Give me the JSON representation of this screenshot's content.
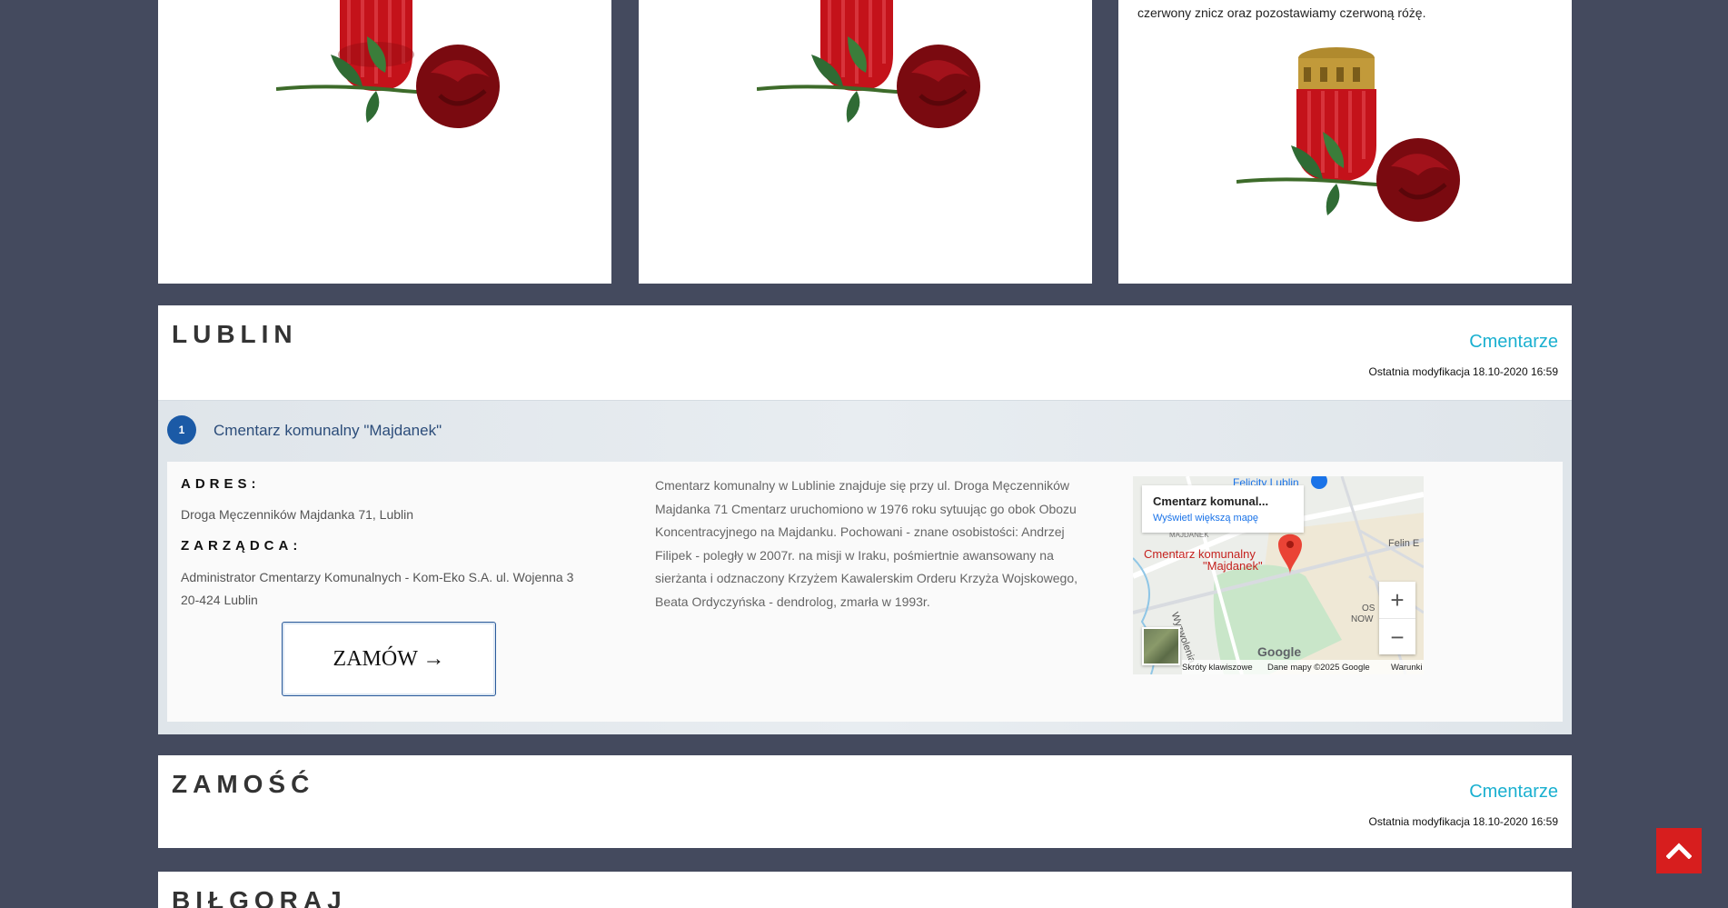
{
  "top_cards": [
    {
      "caption": ""
    },
    {
      "caption": ""
    },
    {
      "caption": "czerwony znicz oraz pozostawiamy czerwoną różę."
    }
  ],
  "lublin": {
    "title": "LUBLIN",
    "category_link": "Cmentarze",
    "modified_label": "Ostatnia modyfikacja",
    "modified_value": "18.10-2020 16:59",
    "cemetery": {
      "number": "1",
      "name": "Cmentarz komunalny \"Majdanek\"",
      "address_label": "ADRES:",
      "address": "Droga Męczenników Majdanka 71, Lublin",
      "manager_label": "ZARZĄDCA:",
      "manager_line1": "Administrator Cmentarzy Komunalnych - Kom-Eko S.A. ul. Wojenna 3",
      "manager_line2": "20-424 Lublin",
      "order_button": "ZAMÓW →",
      "description": "Cmentarz komunalny w Lublinie znajduje się przy ul. Droga Męczenników Majdanka 71 Cmentarz uruchomiono w 1976 roku sytuując go obok Obozu Koncentracyjnego na Majdanku. Pochowani - znane osobistości: Andrzej Filipek - poległy w 2007r. na misji w Iraku, pośmiertnie awansowany na sierżanta i odznaczony Krzyżem Kawalerskim Orderu Krzyża Wojskowego, Beata Ordyczyńska - dendrolog, zmarła w 1993r."
    },
    "map": {
      "info_title": "Cmentarz komunal...",
      "info_link": "Wyświetl większą mapę",
      "poi_felicity": "Felicity Lublin",
      "pin_label_1": "Cmentarz komunalny",
      "pin_label_2": "\"Majdanek\"",
      "felin": "Felin E",
      "street": "Wyzwolenia",
      "majdanek": "MAJDANEK",
      "os": "OS",
      "now": "NOW",
      "google": "Google",
      "footer_shortcuts": "Skróty klawiszowe",
      "footer_data": "Dane mapy ©2025 Google",
      "footer_terms": "Warunki"
    }
  },
  "zamosc": {
    "title": "ZAMOŚĆ",
    "category_link": "Cmentarze",
    "modified_label": "Ostatnia modyfikacja",
    "modified_value": "18.10-2020 16:59"
  },
  "bilgoraj": {
    "title": "BIŁGORAJ"
  },
  "colors": {
    "background": "#444a5e",
    "accent_link": "#1ab0d0",
    "scroll_top": "#d71e1e",
    "badge": "#1b5aa6"
  }
}
